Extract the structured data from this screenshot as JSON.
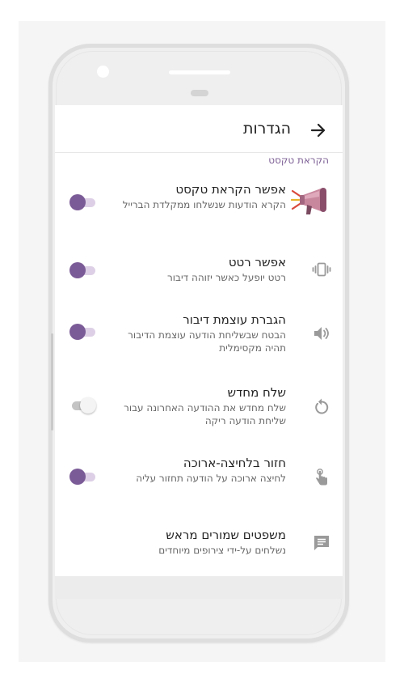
{
  "app_bar": {
    "title": "הגדרות",
    "back_icon": "arrow-right-icon"
  },
  "section": {
    "header": "הקראת טקסט"
  },
  "colors": {
    "accent": "#7b5b97",
    "accent_light": "#ddd0e6",
    "section_header": "#7d5f95"
  },
  "settings": [
    {
      "title": "אפשר הקראת טקסט",
      "summary": "הקרא הודעות שנשלחו ממקלדת הברייל",
      "icon": "megaphone-icon",
      "toggle": "on"
    },
    {
      "title": "אפשר רטט",
      "summary": "רטט יופעל כאשר יזוהה דיבור",
      "icon": "vibration-icon",
      "toggle": "on"
    },
    {
      "title": "הגברת עוצמת דיבור",
      "summary": "הבטח שבשליחת הודעה עוצמת הדיבור תהיה מקסימלית",
      "icon": "volume-icon",
      "toggle": "on"
    },
    {
      "title": "שלח מחדש",
      "summary": "שלח מחדש את ההודעה האחרונה עבור שליחת הודעה ריקה",
      "icon": "replay-icon",
      "toggle": "off"
    },
    {
      "title": "חזור בלחיצה-ארוכה",
      "summary": "לחיצה ארוכה על הודעה תחזור עליה",
      "icon": "touch-hand-icon",
      "toggle": "on"
    },
    {
      "title": "משפטים שמורים מראש",
      "summary": "נשלחים על-ידי צירופים מיוחדים",
      "icon": "message-icon"
    }
  ]
}
